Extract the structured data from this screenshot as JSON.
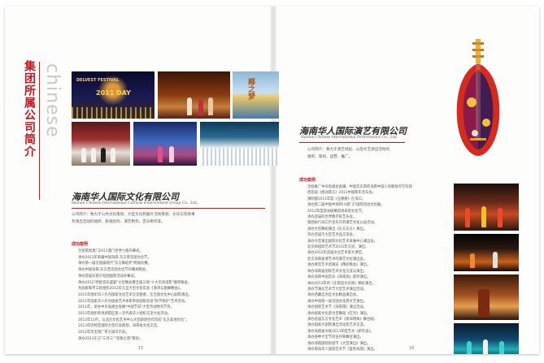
{
  "left_page": {
    "vertical_title": "集团所属公司简介",
    "vertical_english": "chinese",
    "company_title": "海南华人国际文化有限公司",
    "company_subtitle": "Hainan Chinese International Cultural Environment Group Co., Ltd.",
    "intro": [
      "公司简介：致力于公共文化策划、大型文化和图片活动策划、文化与贸易事",
      "务演出活动的组织、影视创作、演艺制作、音乐制作等。"
    ],
    "cases_heading": "成功案例",
    "cases": [
      "全程策划澳门2011澳门世界小姐开幕式。",
      "承办2011年新疆中国海南·东方普克国文化节。",
      "承办第一届全国展现代\"东方舞蹈奖\"终极比赛。",
      "承办中国海南·东方普克国文化节开幕式晚会。",
      "承办首届对南宁旺国国际活动开幕式。",
      "承办2012\"明星音乐盛宴\"大型晚会暨全国三地\"十大华语电影\"颁奖晚会。",
      "为国家和平工程组织2012年元旦大型文化年会《港湾与歌舞晚会》。",
      "2011年组织华人作为国家文化艺术交流使者，在全国文化中心剧院演出。",
      "2011年国家华人作为国家艺术体系参加国际会议\"科学保护\"艺术活动。",
      "2011年，承办中央电视台直播\"中国节日\"大型活动特刊节目。",
      "2012年组织率领湖南区第一次代表华人组织交流大会活动。",
      "2012年12月，与北京文化艺术中心大型剧场合作完成\"东方美地文化\"。",
      "2013年的特定国际大型灯会策划，海南省文化交流。",
      "2012年华宝南广带七城市市会。",
      "承办2013东方\"三月三\"\"欢歌之夜\"策划。"
    ],
    "page_number": "15",
    "photo_labels": {
      "ph1_a": "DELVEST FESTIVAL",
      "ph1_b": "2011 DAY",
      "ph3": "椰之梦"
    }
  },
  "right_page": {
    "company_title": "海南华人国际演艺有限公司",
    "company_subtitle": "Hainan Chinese International Performance Co., Ltd.",
    "intro": [
      "公司简介：致力于演艺经纪、以及文艺演出活动的",
      "组织、策划、运营、推广。"
    ],
    "cases_heading": "成功案例",
    "cases": [
      "全程推广中央电视台直播、中国华东新的海南中国人民解放军空军政",
      "团首届《感动南方》2011中国新年音乐会。",
      "演制建2011年度《玉楼春》在海口。",
      "承办第二届中国中部四川湖门户国际流动文化展。",
      "2012年度游泳联赛首场表现文化节。",
      "承办首届的世界数字民艺乐会。",
      "策划执行海口市音乐厅的演艺文化公益活动。",
      "承办大型舞蹈演出《东方东方》演出。",
      "华办首届市大型艺术品交流会。",
      "承办大型演出国际文化艺术发展中心演出会。",
      "北京和国际艺术节2011年交流，演出。",
      "承办2012年首届文化艺术家大讲堂。",
      "北京海南省博艺术的演艺文化演出会。",
      "承办青年艺术团演员《精彩晚会》演出。",
      "承办海南省国际艺术文化交流与演出。",
      "承办海南中国音乐《海南风》剧目演出。",
      "承办2013年的《东南亚文化周》精彩演出。",
      "承办节演员艺术节大型艺术演出活动。",
      "承办西藏自治区文化精品演出会。",
      "承办中国第一届全国文化周文艺演出。",
      "承办国际艺术节《海南夜》演出活动。",
      "承办国家文化部大型舞蹈《红河》演出。",
      "承办首届东方文化艺术《南海明珠》舞台剧。",
      "承办国家大剧院演出活动及艺术交流。",
      "承办海南省文联2013年度艺术《新年会》。",
      "承办各种大型节目主持和舞台演出。",
      "承办海南国际民俗节《大型演出》演出。",
      "承办南海华人国际艺术节《蓝色海南》演出。"
    ],
    "page_number": "16"
  },
  "colors": {
    "accent": "#c8161d",
    "text": "#555555",
    "title": "#2a2a2a"
  }
}
